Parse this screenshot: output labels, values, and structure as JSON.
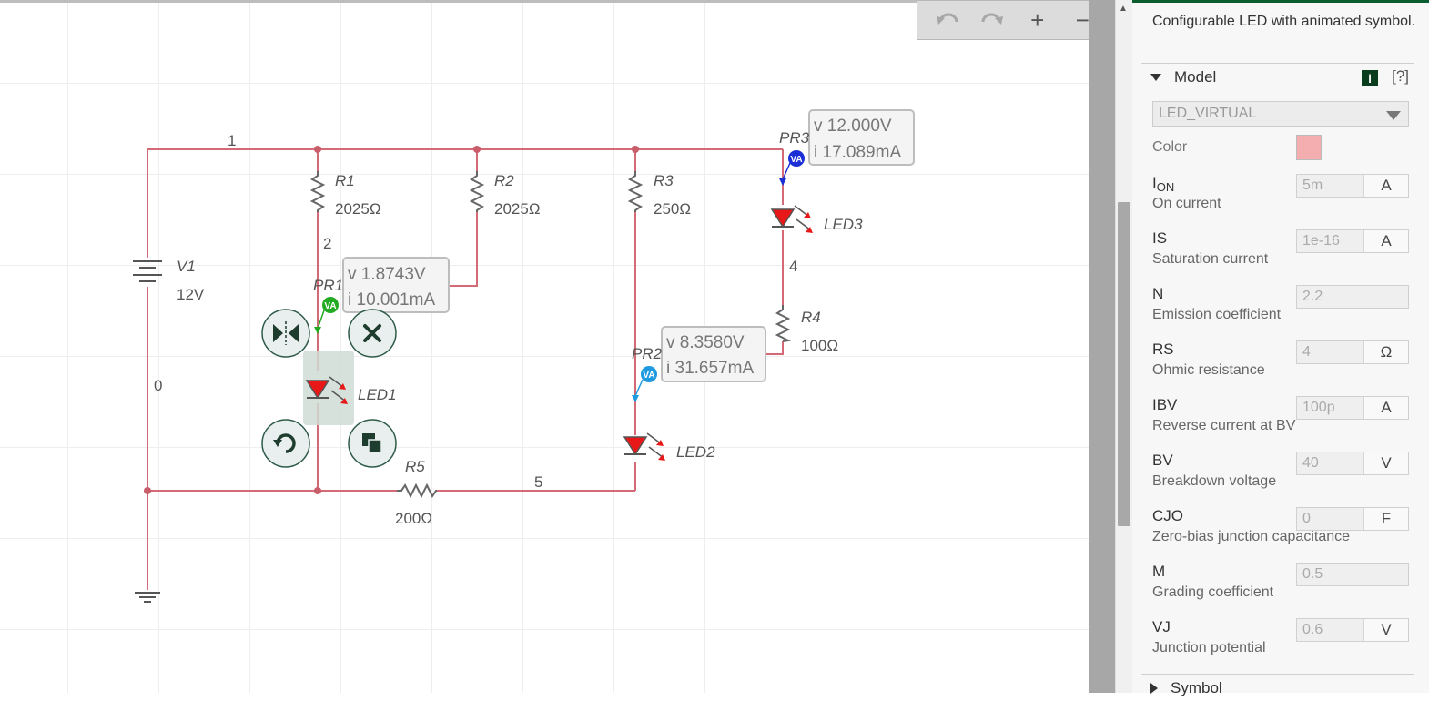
{
  "toolbar": {
    "undo_icon": "undo-icon",
    "redo_icon": "redo-icon",
    "zoom_in": "+",
    "zoom_out": "−"
  },
  "circuit": {
    "nodes": {
      "n1": "1",
      "n2": "2",
      "n0": "0",
      "n4": "4",
      "n5": "5"
    },
    "components": {
      "v1": {
        "name": "V1",
        "value": "12V"
      },
      "r1": {
        "name": "R1",
        "value": "2025Ω"
      },
      "r2": {
        "name": "R2",
        "value": "2025Ω"
      },
      "r3": {
        "name": "R3",
        "value": "250Ω"
      },
      "r4": {
        "name": "R4",
        "value": "100Ω"
      },
      "r5": {
        "name": "R5",
        "value": "200Ω"
      },
      "led1": {
        "name": "LED1"
      },
      "led2": {
        "name": "LED2"
      },
      "led3": {
        "name": "LED3"
      }
    },
    "probes": {
      "pr1": {
        "name": "PR1",
        "badge": "VA",
        "v": "v 1.8743V",
        "i": "i  10.001mA",
        "color": "#22aa22"
      },
      "pr2": {
        "name": "PR2",
        "badge": "VA",
        "v": "v 8.3580V",
        "i": "i  31.657mA",
        "color": "#1e9be0"
      },
      "pr3": {
        "name": "PR3",
        "badge": "VA",
        "v": "v 12.000V",
        "i": "i  17.089mA",
        "color": "#1a2fd6"
      }
    },
    "wire_color": "#d46a76",
    "led_color": "#e81818"
  },
  "context_menu": {
    "flip": "flip-icon",
    "delete": "delete-icon",
    "rotate": "rotate-icon",
    "duplicate": "duplicate-icon"
  },
  "panel": {
    "description": "Configurable LED with animated symbol.",
    "model_section": "Model",
    "info_label": "i",
    "help_label": "[?]",
    "model_value": "LED_VIRTUAL",
    "color_label": "Color",
    "color_value": "#f4aeb0",
    "params": [
      {
        "name": "I",
        "sub": "ON",
        "desc": "On current",
        "value": "5m",
        "unit": "A"
      },
      {
        "name": "IS",
        "sub": "",
        "desc": "Saturation current",
        "value": "1e-16",
        "unit": "A"
      },
      {
        "name": "N",
        "sub": "",
        "desc": "Emission coefficient",
        "value": "2.2",
        "unit": ""
      },
      {
        "name": "RS",
        "sub": "",
        "desc": "Ohmic resistance",
        "value": "4",
        "unit": "Ω"
      },
      {
        "name": "IBV",
        "sub": "",
        "desc": "Reverse current at BV",
        "value": "100p",
        "unit": "A"
      },
      {
        "name": "BV",
        "sub": "",
        "desc": "Breakdown voltage",
        "value": "40",
        "unit": "V"
      },
      {
        "name": "CJO",
        "sub": "",
        "desc": "Zero-bias junction capacitance",
        "value": "0",
        "unit": "F"
      },
      {
        "name": "M",
        "sub": "",
        "desc": "Grading coefficient",
        "value": "0.5",
        "unit": ""
      },
      {
        "name": "VJ",
        "sub": "",
        "desc": "Junction potential",
        "value": "0.6",
        "unit": "V"
      }
    ],
    "symbol_section": "Symbol"
  }
}
